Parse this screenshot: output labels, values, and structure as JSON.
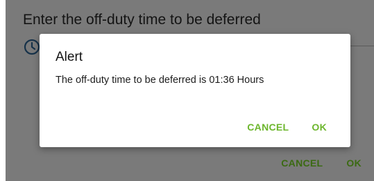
{
  "base_dialog": {
    "title": "Enter the off-duty time to be deferred",
    "icon": "clock-icon",
    "actions": {
      "cancel_label": "CANCEL",
      "ok_label": "OK"
    }
  },
  "alert": {
    "title": "Alert",
    "message": "The off-duty time to be deferred is 01:36 Hours",
    "actions": {
      "cancel_label": "CANCEL",
      "ok_label": "OK"
    }
  },
  "colors": {
    "accent": "#6cb62c",
    "accent_dimmed": "#3b6a12",
    "scrim": "#7a7a7a"
  }
}
